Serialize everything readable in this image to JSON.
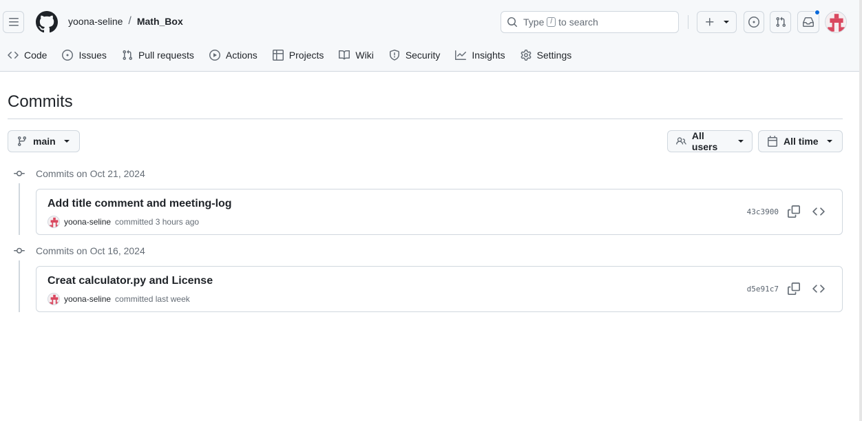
{
  "header": {
    "owner": "yoona-seline",
    "separator": "/",
    "repo": "Math_Box",
    "search": {
      "prefix": "Type",
      "key": "/",
      "suffix": "to search"
    }
  },
  "nav": {
    "items": [
      {
        "label": "Code",
        "icon": "code-icon"
      },
      {
        "label": "Issues",
        "icon": "issue-icon"
      },
      {
        "label": "Pull requests",
        "icon": "pull-request-icon"
      },
      {
        "label": "Actions",
        "icon": "play-icon"
      },
      {
        "label": "Projects",
        "icon": "table-icon"
      },
      {
        "label": "Wiki",
        "icon": "book-icon"
      },
      {
        "label": "Security",
        "icon": "shield-icon"
      },
      {
        "label": "Insights",
        "icon": "graph-icon"
      },
      {
        "label": "Settings",
        "icon": "gear-icon"
      }
    ]
  },
  "page": {
    "title": "Commits",
    "branch": "main",
    "users_filter": "All users",
    "time_filter": "All time"
  },
  "groups": [
    {
      "header": "Commits on Oct 21, 2024",
      "commits": [
        {
          "title": "Add title comment and meeting-log",
          "author": "yoona-seline",
          "when": "committed 3 hours ago",
          "sha": "43c3900"
        }
      ]
    },
    {
      "header": "Commits on Oct 16, 2024",
      "commits": [
        {
          "title": "Creat calculator.py and License",
          "author": "yoona-seline",
          "when": "committed last week",
          "sha": "d5e91c7"
        }
      ]
    }
  ],
  "colors": {
    "accent": "#0969da",
    "avatar": "#d9485f",
    "border": "#d0d7de",
    "muted": "#656d76"
  }
}
